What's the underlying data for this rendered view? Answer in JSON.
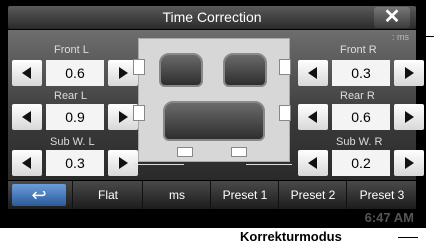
{
  "title": "Time Correction",
  "unit": ": ms",
  "channels": [
    {
      "label": "Front L",
      "value": "0.6"
    },
    {
      "label": "Front R",
      "value": "0.3"
    },
    {
      "label": "Rear L",
      "value": "0.9"
    },
    {
      "label": "Rear R",
      "value": "0.6"
    },
    {
      "label": "Sub W. L",
      "value": "0.3"
    },
    {
      "label": "Sub W. R",
      "value": "0.2"
    }
  ],
  "tabs": [
    "Flat",
    "ms",
    "Preset 1",
    "Preset 2",
    "Preset 3"
  ],
  "clock": "6:47 AM",
  "caption": "Korrekturmodus",
  "icons": {
    "close": "close-icon",
    "back": "back-arrow-icon",
    "left": "left-arrow-icon",
    "right": "right-arrow-icon"
  }
}
